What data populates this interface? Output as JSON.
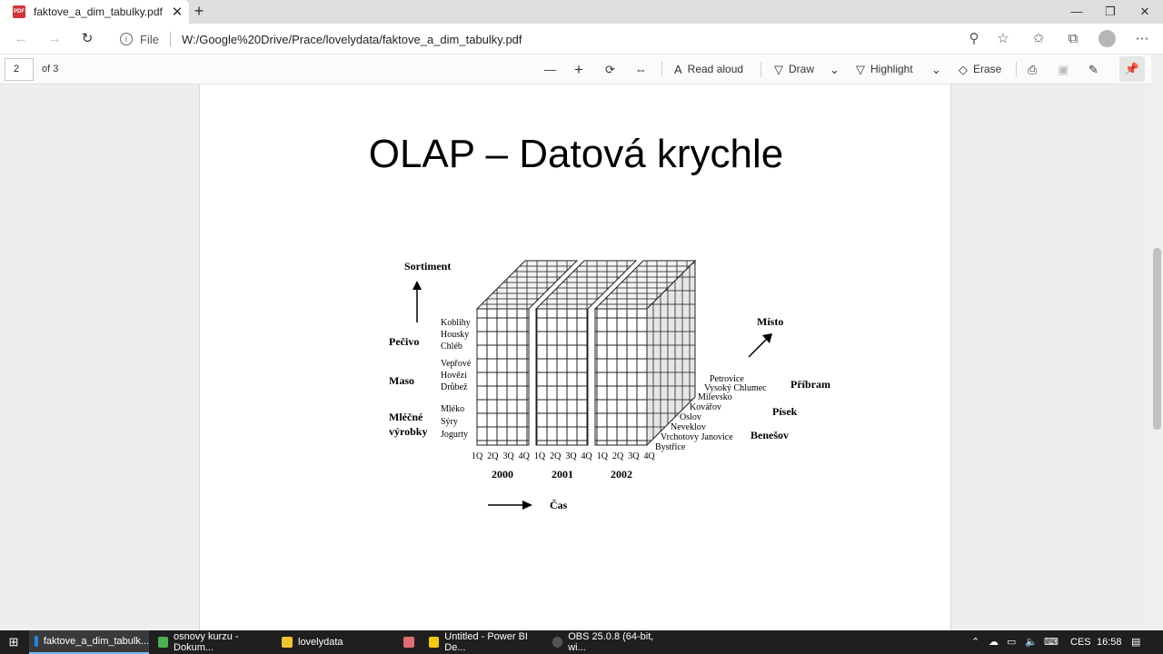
{
  "browser": {
    "tab_title": "faktove_a_dim_tabulky.pdf",
    "tab_icon": "PDF",
    "new_tab": "+",
    "scheme": "File",
    "url": "W:/Google%20Drive/Prace/lovelydata/faktove_a_dim_tabulky.pdf"
  },
  "pdf_toolbar": {
    "page_current": "2",
    "page_of": "of 3",
    "read_aloud": "Read aloud",
    "draw": "Draw",
    "highlight": "Highlight",
    "erase": "Erase"
  },
  "slide": {
    "title": "OLAP – Datová krychle",
    "labels": {
      "sortiment": "Sortiment",
      "misto": "Místo",
      "cas": "Čas",
      "pecivo": "Pečivo",
      "maso": "Maso",
      "mlecne1": "Mléčné",
      "mlecne2": "výrobky",
      "koblihy": "Koblihy",
      "housky": "Housky",
      "chleb": "Chléb",
      "veprove": "Vepřové",
      "hovezi": "Hovězí",
      "drubez": "Drůbež",
      "mleko": "Mléko",
      "syry": "Sýry",
      "jogurty": "Jogurty",
      "pribram": "Příbram",
      "pisek": "Písek",
      "benesov": "Benešov",
      "petrovice": "Petrovice",
      "vysoky": "Vysoký Chlumec",
      "milevsko": "Milevsko",
      "kovarov": "Kovářov",
      "oslov": "Oslov",
      "neveklov": "Neveklov",
      "vrchotovy": "Vrchotovy Janovice",
      "bystrice": "Bystřice",
      "y2000": "2000",
      "y2001": "2001",
      "y2002": "2002",
      "quarters": "1Q  2Q  3Q  4Q  1Q  2Q  3Q  4Q  1Q  2Q  3Q  4Q"
    }
  },
  "taskbar": {
    "items": [
      {
        "label": "faktove_a_dim_tabulk...",
        "color": "#1e88e5"
      },
      {
        "label": "osnovy kurzu - Dokum...",
        "color": "#4caf50"
      },
      {
        "label": "lovelydata",
        "color": "#f4c430"
      },
      {
        "label": "Untitled - Power BI De...",
        "color": "#f2c811"
      },
      {
        "label": "OBS 25.0.8 (64-bit, wi...",
        "color": "#555555"
      }
    ],
    "lang": "CES",
    "time": "16:58"
  }
}
